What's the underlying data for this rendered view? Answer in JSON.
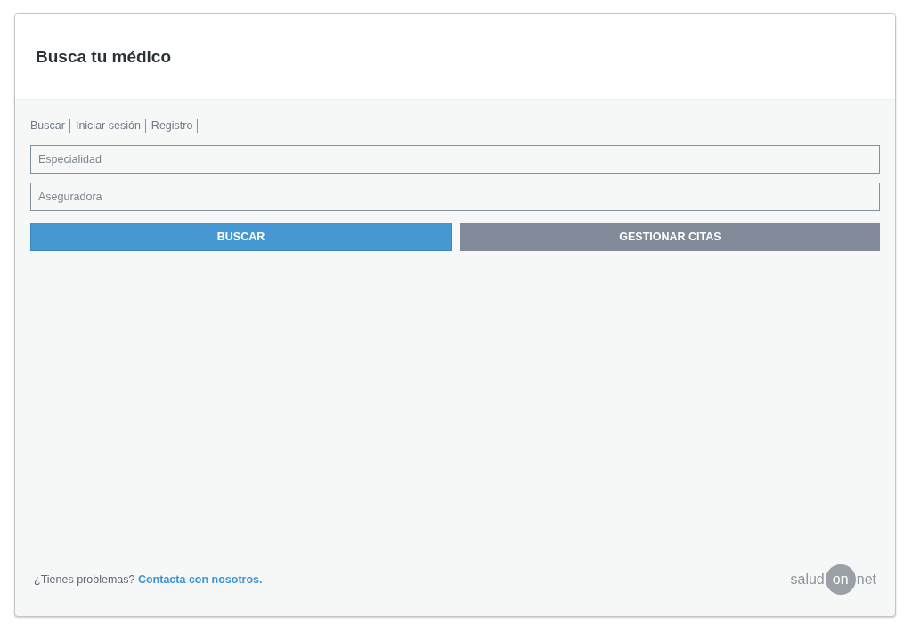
{
  "header": {
    "title": "Busca tu médico"
  },
  "nav": [
    {
      "label": "Buscar"
    },
    {
      "label": "Iniciar sesión"
    },
    {
      "label": "Registro"
    }
  ],
  "fields": [
    {
      "placeholder": "Especialidad"
    },
    {
      "placeholder": "Aseguradora"
    }
  ],
  "buttons": [
    {
      "label": "BUSCAR",
      "kind": "primary"
    },
    {
      "label": "GESTIONAR CITAS",
      "kind": "secondary"
    }
  ],
  "footer": {
    "text": "¿Tienes problemas?",
    "link": "Contacta con nosotros.",
    "logo": [
      "salud",
      "on",
      "net"
    ]
  }
}
